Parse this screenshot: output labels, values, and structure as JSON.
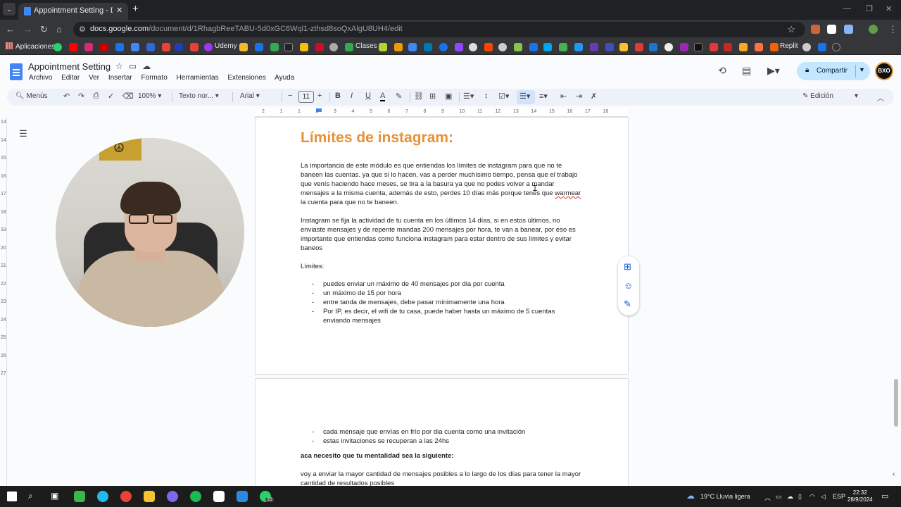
{
  "browser": {
    "tab_title": "Appointment Setting - Docume",
    "url_host": "docs.google.com",
    "url_path": "/document/d/1RhagbReeTABU-5d0xGC6Wql1-zthsd8soQxAlgU8UH4/edit",
    "bookmarks": {
      "apps_label": "Aplicaciones",
      "udemy": "Udemy",
      "clases": "Clases",
      "replit": "Replit"
    }
  },
  "docs": {
    "title": "Appointment Setting",
    "menu": [
      "Archivo",
      "Editar",
      "Ver",
      "Insertar",
      "Formato",
      "Herramientas",
      "Extensiones",
      "Ayuda"
    ],
    "share_label": "Compartir",
    "avatar_text": "BXO",
    "toolbar": {
      "search_label": "Menús",
      "zoom": "100%",
      "style": "Texto nor...",
      "font": "Arial",
      "font_size": "11",
      "mode": "Edición"
    },
    "ruler_ticks": [
      "2",
      "1",
      "1",
      "2",
      "3",
      "4",
      "5",
      "6",
      "7",
      "8",
      "9",
      "10",
      "11",
      "12",
      "13",
      "14",
      "15",
      "16",
      "17",
      "18"
    ],
    "vruler_ticks": [
      "13",
      "14",
      "15",
      "16",
      "17",
      "18",
      "19",
      "20",
      "21",
      "22",
      "23",
      "24",
      "25",
      "26",
      "27"
    ]
  },
  "document": {
    "heading": "Límites de instagram:",
    "para1_a": "La importancia de este módulo es que entiendas los límites de instagram para que no te baneen las cuentas. ya que si lo hacen, vas a perder muchísimo tiempo, pensa que el trabajo que venís haciendo hace meses, se tira a la basura ya que no podes volver a mandar mensajes a la misma cuenta, además de esto, perdes 10 días más porque tenes que ",
    "para1_warmear": "warmear",
    "para1_b": " la cuenta para que no te baneen.",
    "para2": "Instagram se fija la actividad de tu cuenta en los últimos 14 días, si en estos últimos, no enviaste mensajes y de repente mandas 200 mensajes por hora, te van a banear, por eso es importante que entiendas como funciona instagram para estar dentro de sus límites y evitar baneos",
    "limits_label": "Límites:",
    "limits": [
      "puedes enviar un máximo de 40 mensajes por dia por cuenta",
      "un máximo de 15 por hora",
      "entre tanda de mensajes, debe pasar mínimamente una hora",
      "Por IP, es decir, el wifi de tu casa, puede haber hasta un máximo de 5 cuentas enviando mensajes"
    ],
    "page2_list": [
      "cada mensaje que envías en frío por dia cuenta como una invitación",
      "estas invitaciones se recuperan a las 24hs"
    ],
    "mentality_heading": "aca necesito que tu mentalidad sea la siguiente:",
    "mentality_text": "voy a enviar la mayor cantidad de mensajes posibles a lo largo de los días para tener la mayor cantidad de resultados posibles"
  },
  "taskbar": {
    "whatsapp_badge": "35",
    "weather": "19°C  Lluvia ligera",
    "lang": "ESP",
    "time": "22:32",
    "date": "28/9/2024"
  },
  "colors": {
    "heading_orange": "#e69138",
    "share_bg": "#c2e7ff",
    "accent_blue": "#0b57d0"
  }
}
